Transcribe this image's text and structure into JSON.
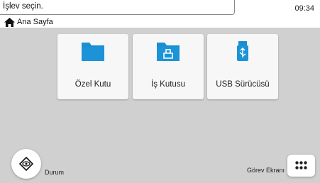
{
  "header": {
    "prompt": "İşlev seçin.",
    "time": "09:34"
  },
  "breadcrumb": {
    "icon": "home-icon",
    "label": "Ana Sayfa"
  },
  "tiles": [
    {
      "label": "Özel Kutu",
      "icon": "folder-icon"
    },
    {
      "label": "İş Kutusu",
      "icon": "job-box-folder-icon"
    },
    {
      "label": "USB Sürücüsü",
      "icon": "usb-icon"
    }
  ],
  "footer": {
    "status_label": "Durum",
    "status_icon": "status-eye-icon",
    "task_label": "Görev Ekranı",
    "task_icon": "grid-dots-icon"
  },
  "colors": {
    "accent": "#1a8fd0",
    "background": "#d0d0d0",
    "tile": "#f7f7f7"
  }
}
